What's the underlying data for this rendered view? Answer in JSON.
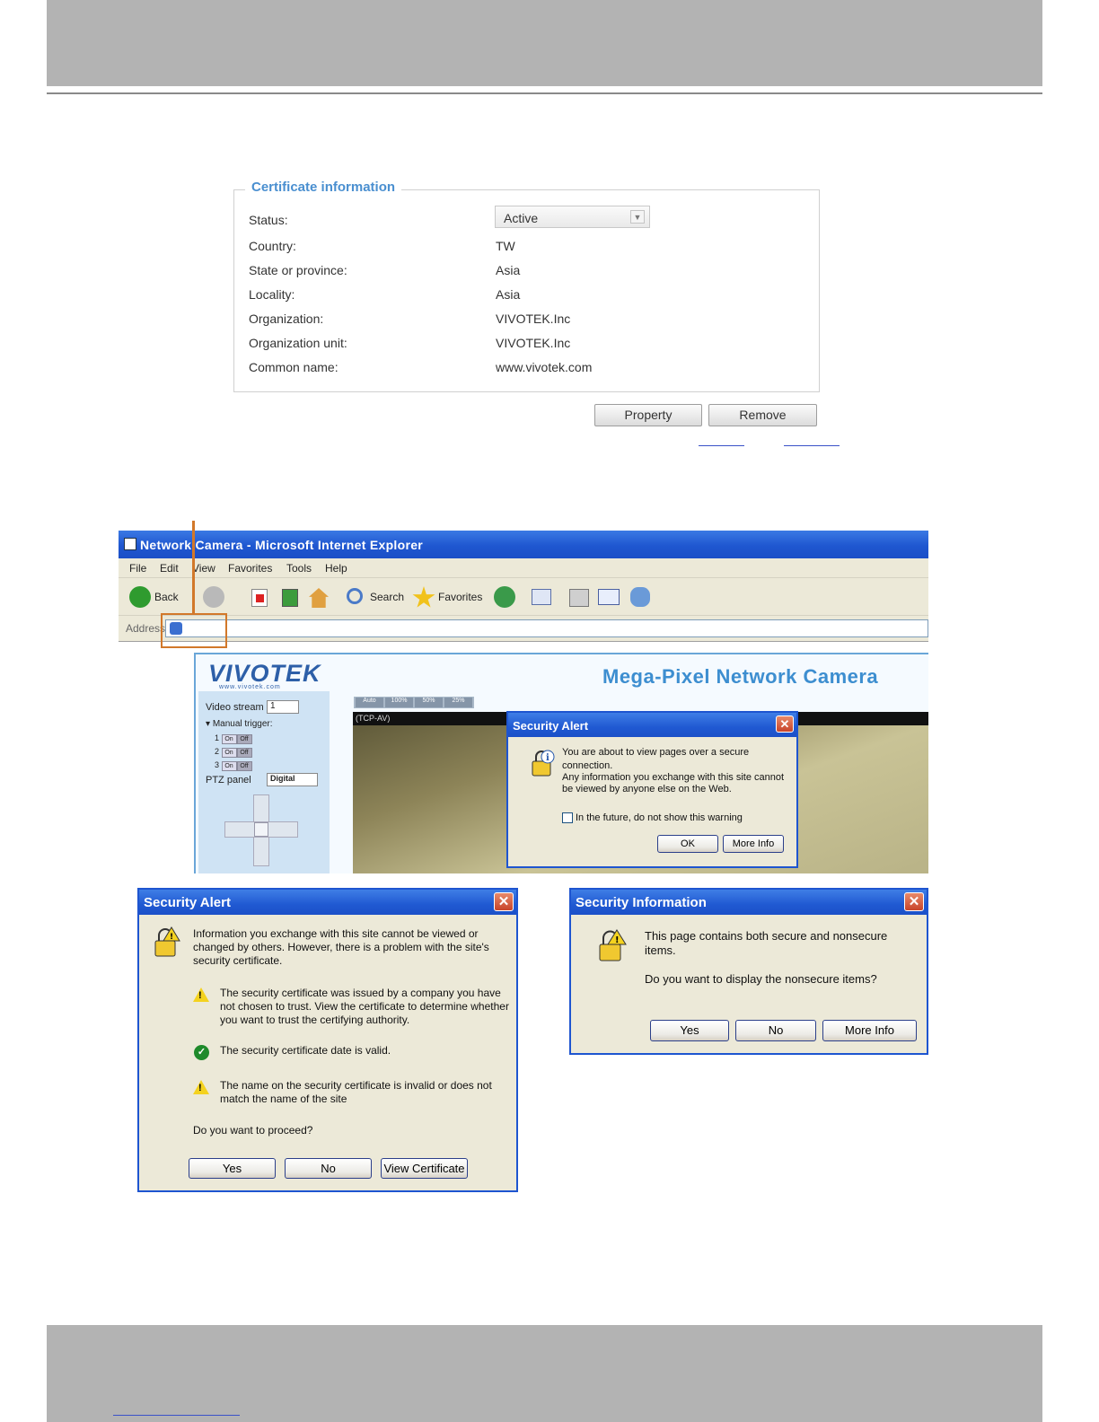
{
  "certificate": {
    "legend": "Certificate information",
    "rows": [
      {
        "label": "Status:",
        "value": "Active"
      },
      {
        "label": "Country:",
        "value": "TW"
      },
      {
        "label": "State or province:",
        "value": "Asia"
      },
      {
        "label": "Locality:",
        "value": "Asia"
      },
      {
        "label": "Organization:",
        "value": "VIVOTEK.Inc"
      },
      {
        "label": "Organization unit:",
        "value": "VIVOTEK.Inc"
      },
      {
        "label": "Common name:",
        "value": "www.vivotek.com"
      }
    ],
    "property_label": "Property",
    "remove_label": "Remove"
  },
  "ie": {
    "title": "Network Camera - Microsoft Internet Explorer",
    "menu": [
      "File",
      "Edit",
      "View",
      "Favorites",
      "Tools",
      "Help"
    ],
    "toolbar": {
      "back": "Back",
      "search": "Search",
      "favorites": "Favorites"
    },
    "address_label": "Address",
    "camera": {
      "logo": "VIVOTEK",
      "logo_sub": "www.vivotek.com",
      "heading": "Mega-Pixel Network Camera",
      "video_stream_label": "Video stream",
      "video_stream_value": "1",
      "manual_trigger_label": "Manual trigger",
      "triggers": [
        "1",
        "2",
        "3"
      ],
      "on_label": "On",
      "off_label": "Off",
      "ptz_label": "PTZ panel",
      "ptz_value": "Digital",
      "zoom_buttons": [
        "Auto",
        "100%",
        "50%",
        "25%"
      ],
      "protocol": "(TCP-AV)"
    },
    "alert": {
      "title": "Security Alert",
      "line1": "You are about to view pages over a secure connection.",
      "line2": "Any information you exchange with this site cannot be viewed by anyone else on the Web.",
      "checkbox": "In the future, do not show this warning",
      "ok": "OK",
      "more_info": "More Info"
    }
  },
  "security_alert": {
    "title": "Security Alert",
    "intro": "Information you exchange with this site cannot be viewed or changed by others. However, there is a problem with the site's security certificate.",
    "items": [
      {
        "icon": "warning-icon",
        "text": "The security certificate was issued by a company you have not chosen to trust. View the certificate to determine whether you want to trust the certifying authority."
      },
      {
        "icon": "check-icon",
        "text": "The security certificate date is valid."
      },
      {
        "icon": "warning-icon",
        "text": "The name on the security certificate is invalid or does not match the name of the site"
      }
    ],
    "question": "Do you want to proceed?",
    "yes": "Yes",
    "no": "No",
    "view_certificate": "View Certificate"
  },
  "security_information": {
    "title": "Security Information",
    "line1": "This page contains both secure and nonsecure items.",
    "line2": "Do you want to display the nonsecure items?",
    "yes": "Yes",
    "no": "No",
    "more_info": "More Info"
  },
  "colors": {
    "legend_blue": "#4a8fd0",
    "xp_title_blue": "#2059d2",
    "callout_orange": "#d2782a",
    "band_gray": "#b3b3b3"
  }
}
